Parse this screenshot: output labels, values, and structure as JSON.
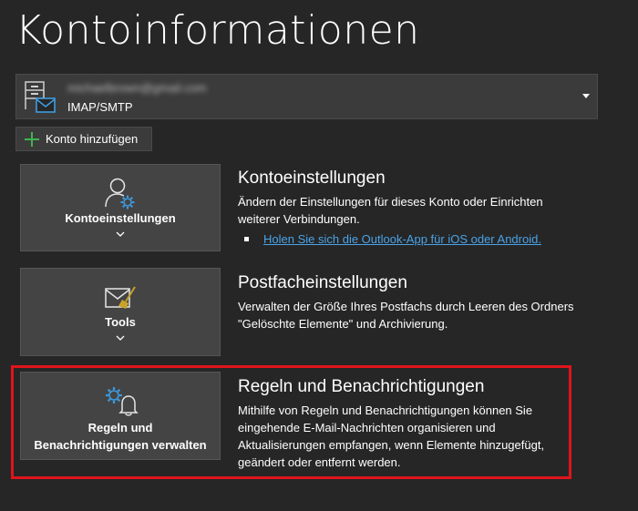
{
  "page": {
    "title": "Kontoinformationen"
  },
  "account": {
    "email": "michaelbrown@gmail.com",
    "type": "IMAP/SMTP"
  },
  "add_account": {
    "label": "Konto hinzufügen"
  },
  "sections": {
    "account_settings": {
      "button_label": "Kontoeinstellungen",
      "heading": "Kontoeinstellungen",
      "description": "Ändern der Einstellungen für dieses Konto oder Einrichten weiterer Verbindungen.",
      "link": "Holen Sie sich die Outlook-App für iOS oder Android."
    },
    "mailbox_settings": {
      "button_label": "Tools",
      "heading": "Postfacheinstellungen",
      "description": "Verwalten der Größe Ihres Postfachs durch Leeren des Ordners \"Gelöschte Elemente\" und Archivierung."
    },
    "rules": {
      "button_label_line1": "Regeln und",
      "button_label_line2": "Benachrichtigungen verwalten",
      "heading": "Regeln und Benachrichtigungen",
      "description": "Mithilfe von Regeln und Benachrichtigungen können Sie eingehende E-Mail-Nachrichten organisieren und Aktualisierungen empfangen, wenn Elemente hinzugefügt, geändert oder entfernt werden."
    }
  },
  "colors": {
    "background": "#262626",
    "accent": "#4aa3e8",
    "highlight": "#e0141b",
    "plus": "#3fb34f"
  },
  "icons": {
    "account": "account-mail-icon",
    "dropdown": "chevron-down-icon",
    "add": "plus-icon",
    "user_settings": "user-gear-icon",
    "tools": "mailbox-broom-icon",
    "rules": "gear-bell-icon"
  }
}
